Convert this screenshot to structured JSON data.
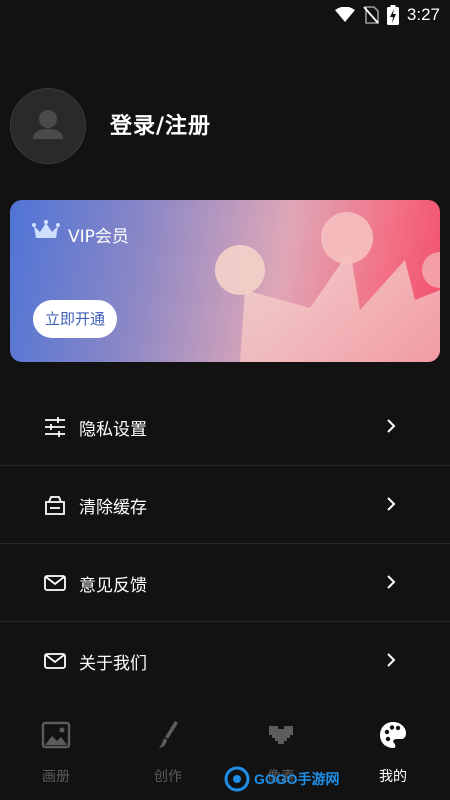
{
  "status": {
    "time": "3:27"
  },
  "profile": {
    "login_label": "登录/注册"
  },
  "vip": {
    "title": "VIP会员",
    "button": "立即开通"
  },
  "menu": [
    {
      "label": "隐私设置",
      "icon": "sliders-icon"
    },
    {
      "label": "清除缓存",
      "icon": "basket-icon"
    },
    {
      "label": "意见反馈",
      "icon": "mail-icon"
    },
    {
      "label": "关于我们",
      "icon": "mail-icon"
    }
  ],
  "tabs": [
    {
      "label": "画册",
      "icon": "image-icon",
      "active": false
    },
    {
      "label": "创作",
      "icon": "brush-icon",
      "active": false
    },
    {
      "label": "像素",
      "icon": "pixel-heart-icon",
      "active": false
    },
    {
      "label": "我的",
      "icon": "palette-icon",
      "active": true
    }
  ],
  "watermark": {
    "text": "GOGO手游网"
  }
}
